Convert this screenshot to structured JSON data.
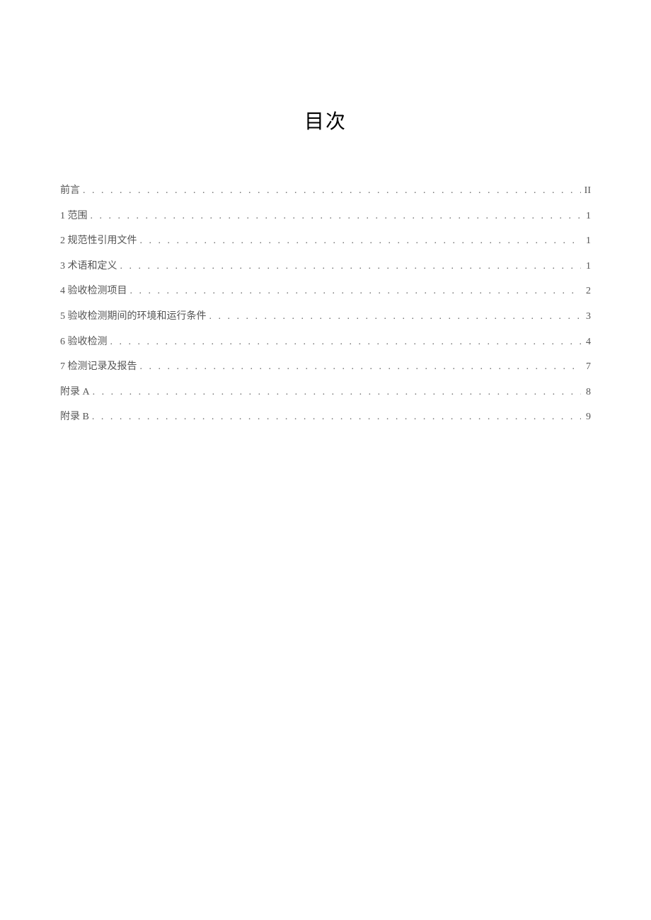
{
  "title": "目次",
  "toc": [
    {
      "label": "前言",
      "page": "II"
    },
    {
      "label": "1 范围",
      "page": "1"
    },
    {
      "label": "2 规范性引用文件",
      "page": "1"
    },
    {
      "label": "3 术语和定义",
      "page": "1"
    },
    {
      "label": "4 验收检测项目",
      "page": "2"
    },
    {
      "label": "5 验收检测期间的环境和运行条件",
      "page": "3"
    },
    {
      "label": "6 验收检测",
      "page": "4"
    },
    {
      "label": "7 检测记录及报告",
      "page": "7"
    },
    {
      "label": "附录 A",
      "page": "8"
    },
    {
      "label": "附录 B",
      "page": "9"
    }
  ]
}
